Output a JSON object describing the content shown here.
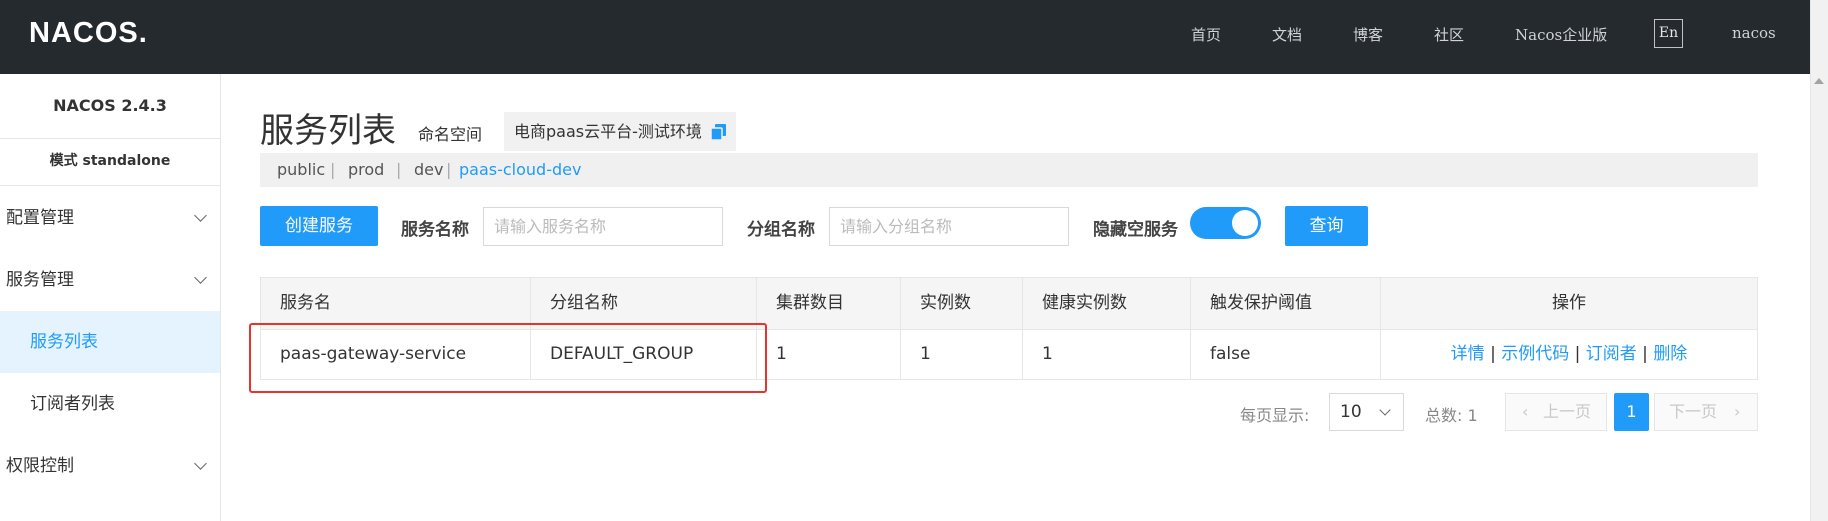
{
  "brand": {
    "logo_text": "NACOS."
  },
  "topnav": {
    "items": [
      "首页",
      "文档",
      "博客",
      "社区",
      "Nacos企业版"
    ],
    "lang_button": "En",
    "user": "nacos"
  },
  "sidebar": {
    "version": "NACOS 2.4.3",
    "mode": "模式 standalone",
    "items": [
      {
        "label": "配置管理",
        "expanded": false
      },
      {
        "label": "服务管理",
        "expanded": true
      },
      {
        "label": "服务列表",
        "active": true
      },
      {
        "label": "订阅者列表",
        "active": false
      },
      {
        "label": "权限控制",
        "expanded": false
      }
    ]
  },
  "main": {
    "title": "服务列表",
    "namespace_label": "命名空间",
    "namespace_value": "电商paas云平台-测试环境",
    "namespaces": [
      "public",
      "prod",
      "dev",
      "paas-cloud-dev"
    ],
    "active_namespace": "paas-cloud-dev"
  },
  "filters": {
    "create_button": "创建服务",
    "service_name_label": "服务名称",
    "service_name_placeholder": "请输入服务名称",
    "group_name_label": "分组名称",
    "group_name_placeholder": "请输入分组名称",
    "hide_empty_label": "隐藏空服务",
    "hide_empty_on": true,
    "query_button": "查询"
  },
  "table": {
    "columns": [
      "服务名",
      "分组名称",
      "集群数目",
      "实例数",
      "健康实例数",
      "触发保护阈值",
      "操作"
    ],
    "rows": [
      {
        "service": "paas-gateway-service",
        "group": "DEFAULT_GROUP",
        "clusters": "1",
        "instances": "1",
        "healthy": "1",
        "protect": "false",
        "actions": [
          "详情",
          "示例代码",
          "订阅者",
          "删除"
        ]
      }
    ]
  },
  "pagination": {
    "per_page_label": "每页显示:",
    "per_page": "10",
    "total_label": "总数: 1",
    "prev": "上一页",
    "current": "1",
    "next": "下一页"
  },
  "colors": {
    "primary": "#209bfa",
    "header_bg": "#252a2f",
    "highlight_box": "#e5332e",
    "active_item_bg": "#e4f3fe"
  }
}
